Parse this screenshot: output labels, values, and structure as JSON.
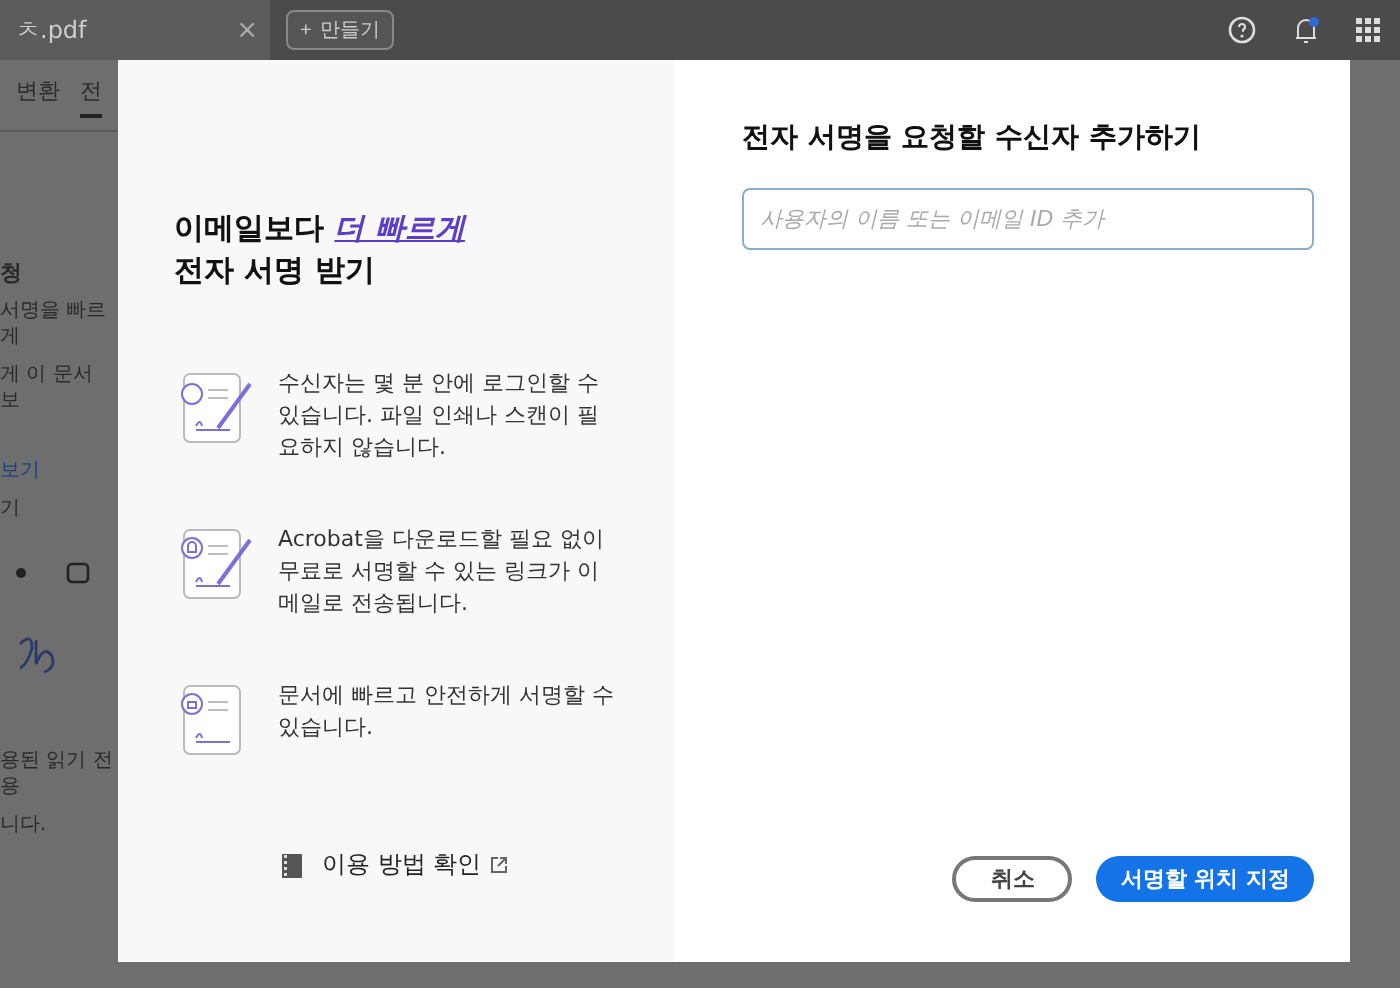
{
  "tab_bar": {
    "file_tab": {
      "title": "ㅊ.pdf",
      "close": "×",
      "selected": true
    },
    "new_button": {
      "icon": "+",
      "label": "만들기"
    }
  },
  "sidebar": {
    "tabs": [
      {
        "label": "변환",
        "selected": false
      },
      {
        "label": "전",
        "selected": true
      }
    ],
    "items": [
      {
        "kind": "heading",
        "text": "청"
      },
      {
        "kind": "text",
        "text": "서명을 빠르게"
      },
      {
        "kind": "text",
        "text": "게 이 문서 보"
      },
      {
        "kind": "link",
        "text": "보기"
      },
      {
        "kind": "text",
        "text": "기"
      },
      {
        "kind": "tools"
      },
      {
        "kind": "signature"
      },
      {
        "kind": "text",
        "text": "용된 읽기 전용"
      },
      {
        "kind": "text",
        "text": "니다."
      }
    ]
  },
  "dialog": {
    "promo": {
      "title_start": "이메일보다",
      "title_highlight": "더 빠르게",
      "title_end": "전자 서명 받기",
      "features": [
        {
          "kind": "stopwatch",
          "text": "수신자는 몇 분 안에 로그인할 수 있습니다. 파일 인쇄나 스캔이 필요하지 않습니다."
        },
        {
          "kind": "bell",
          "text": "Acrobat을 다운로드할 필요 없이 무료로 서명할 수 있는 링크가 이메일로 전송됩니다."
        },
        {
          "kind": "lock",
          "text": "문서에 빠르고 안전하게 서명할 수 있습니다."
        }
      ],
      "help_link": "이용 방법 확인"
    },
    "heading": "전자 서명을 요청할 수신자 추가하기",
    "recipient_field": {
      "placeholder": "사용자의 이름 또는 이메일 ID 추가"
    },
    "buttons": [
      {
        "kind": "secondary",
        "label": "취소"
      },
      {
        "kind": "primary",
        "label": "서명할 위치 지정"
      }
    ]
  }
}
